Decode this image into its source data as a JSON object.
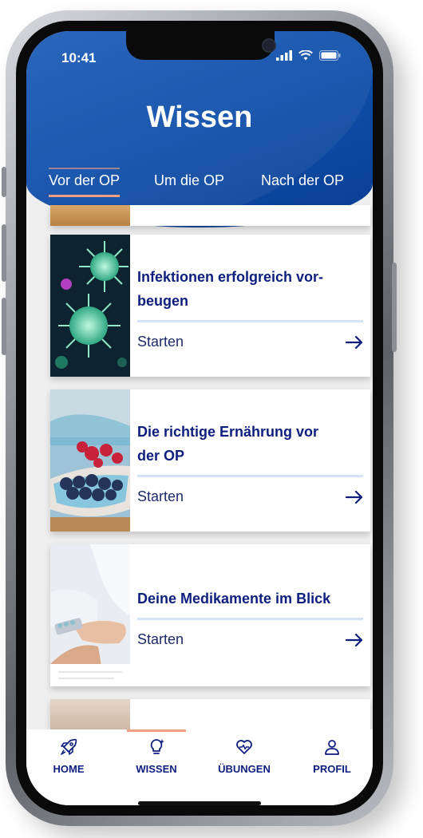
{
  "status_bar": {
    "time": "10:41"
  },
  "header": {
    "title": "Wissen"
  },
  "tabs": [
    {
      "label": "Vor der OP",
      "active": true
    },
    {
      "label": "Um die OP",
      "active": false
    },
    {
      "label": "Nach der OP",
      "active": false
    }
  ],
  "cards": [
    {
      "title_line1": "Infektionen erfolgreich vor-",
      "title_line2": "beugen",
      "action": "Starten",
      "image": "virus-image"
    },
    {
      "title_line1": "Die richtige Ernährung vor",
      "title_line2": "der OP",
      "action": "Starten",
      "image": "berries-image"
    },
    {
      "title_line1": "Deine Medikamente im Blick",
      "title_line2": "",
      "action": "Starten",
      "image": "medication-image"
    }
  ],
  "tab_bar": {
    "items": [
      {
        "label": "HOME",
        "icon": "rocket-icon"
      },
      {
        "label": "WISSEN",
        "icon": "lightbulb-icon"
      },
      {
        "label": "ÜBUNGEN",
        "icon": "heart-pulse-icon"
      },
      {
        "label": "PROFIL",
        "icon": "person-icon"
      }
    ]
  },
  "colors": {
    "header_blue": "#0e4ea9",
    "accent_salmon": "#f0a184",
    "navy_text": "#0e1e7e",
    "divider": "#d4e3f7"
  }
}
